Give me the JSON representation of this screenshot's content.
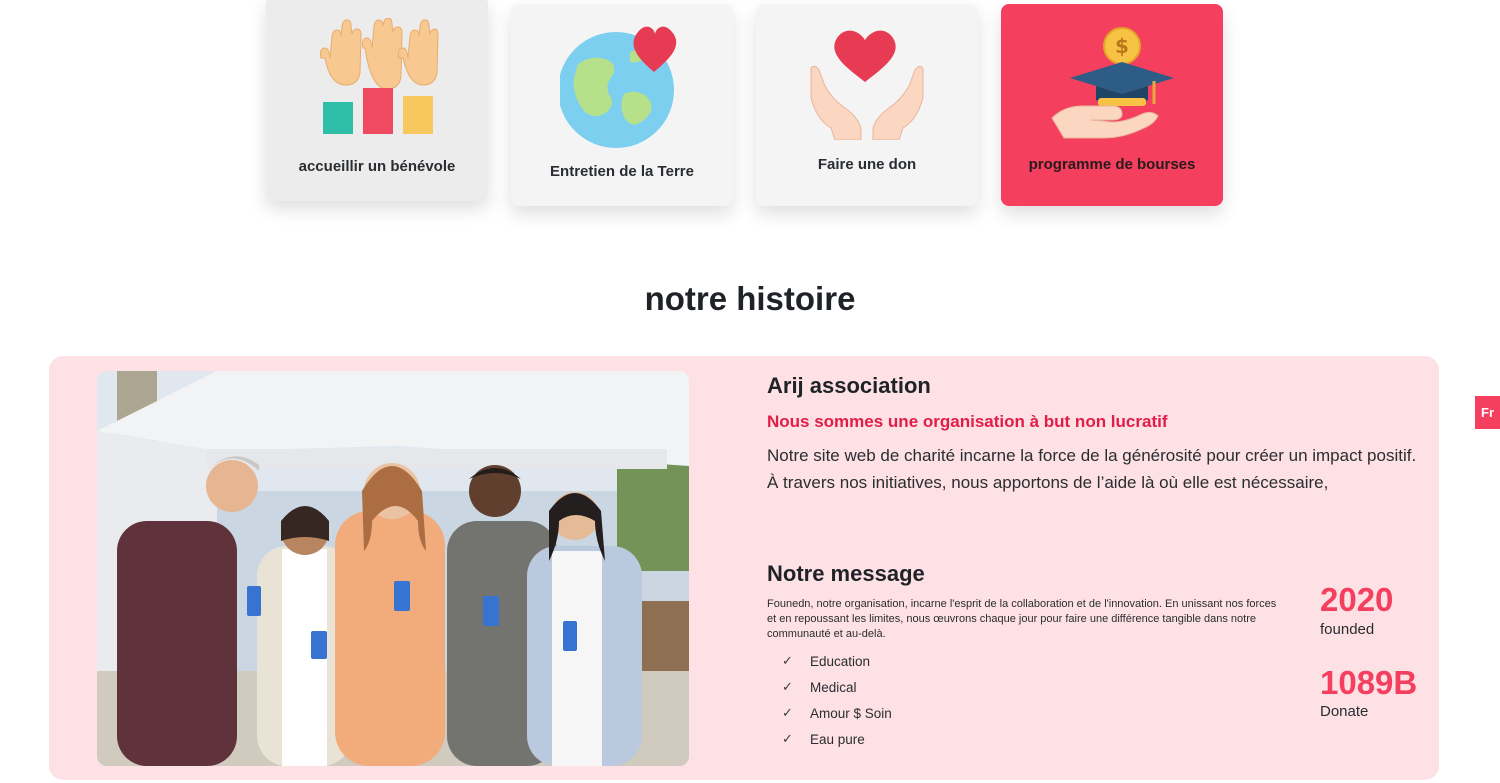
{
  "services": [
    {
      "label": "accueillir un bénévole",
      "icon": "raised-hands-icon"
    },
    {
      "label": "Entretien de la Terre",
      "icon": "earth-heart-icon"
    },
    {
      "label": "Faire une don",
      "icon": "hands-heart-icon"
    },
    {
      "label": "programme de bourses",
      "icon": "scholarship-hand-icon"
    }
  ],
  "section_title": "notre histoire",
  "story": {
    "org_name": "Arij association",
    "tagline": "Nous sommes une organisation à but non lucratif",
    "intro": "Notre site web de charité incarne la force de la générosité pour créer un impact positif. À travers nos initiatives, nous apportons de l’aide là où elle est nécessaire,",
    "message_title": "Notre message",
    "message_text": "Founedn, notre organisation, incarne l'esprit de la collaboration et de l'innovation. En unissant nos forces et en repoussant les limites, nous œuvrons chaque jour pour faire une différence tangible dans notre communauté et au-delà.",
    "checklist": [
      "Education",
      "Medical",
      "Amour $ Soin",
      "Eau pure"
    ],
    "stats": [
      {
        "value": "2020",
        "caption": "founded"
      },
      {
        "value": "1089B",
        "caption": "Donate"
      }
    ]
  },
  "language_button": "Fr",
  "colors": {
    "accent": "#f43f5e",
    "panel_bg": "#fde1e4",
    "tagline": "#e11d48",
    "card_bg": "#f4f4f4"
  }
}
